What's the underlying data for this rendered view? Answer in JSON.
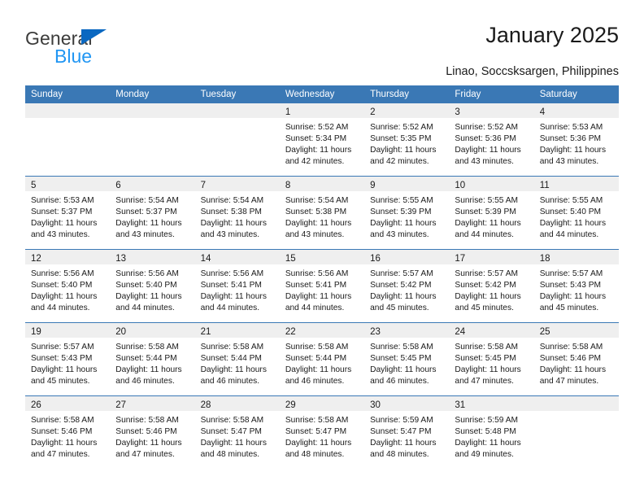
{
  "brand": {
    "name_top": "General",
    "name_bottom": "Blue",
    "accent_color": "#2196f3",
    "triangle_color": "#0a68c1",
    "top_text_color": "#3c3c3b"
  },
  "header": {
    "title": "January 2025",
    "subtitle": "Linao, Soccsksargen, Philippines"
  },
  "theme": {
    "header_bg": "#3a78b5",
    "header_text": "#ffffff",
    "daynum_band_bg": "#efefef",
    "row_divider": "#3a78b5",
    "cell_bg": "#ffffff",
    "text": "#1a1a1a"
  },
  "calendar": {
    "weekday_headers": [
      "Sunday",
      "Monday",
      "Tuesday",
      "Wednesday",
      "Thursday",
      "Friday",
      "Saturday"
    ],
    "weeks": [
      [
        {
          "day": "",
          "lines": []
        },
        {
          "day": "",
          "lines": []
        },
        {
          "day": "",
          "lines": []
        },
        {
          "day": "1",
          "lines": [
            "Sunrise: 5:52 AM",
            "Sunset: 5:34 PM",
            "Daylight: 11 hours",
            "and 42 minutes."
          ]
        },
        {
          "day": "2",
          "lines": [
            "Sunrise: 5:52 AM",
            "Sunset: 5:35 PM",
            "Daylight: 11 hours",
            "and 42 minutes."
          ]
        },
        {
          "day": "3",
          "lines": [
            "Sunrise: 5:52 AM",
            "Sunset: 5:36 PM",
            "Daylight: 11 hours",
            "and 43 minutes."
          ]
        },
        {
          "day": "4",
          "lines": [
            "Sunrise: 5:53 AM",
            "Sunset: 5:36 PM",
            "Daylight: 11 hours",
            "and 43 minutes."
          ]
        }
      ],
      [
        {
          "day": "5",
          "lines": [
            "Sunrise: 5:53 AM",
            "Sunset: 5:37 PM",
            "Daylight: 11 hours",
            "and 43 minutes."
          ]
        },
        {
          "day": "6",
          "lines": [
            "Sunrise: 5:54 AM",
            "Sunset: 5:37 PM",
            "Daylight: 11 hours",
            "and 43 minutes."
          ]
        },
        {
          "day": "7",
          "lines": [
            "Sunrise: 5:54 AM",
            "Sunset: 5:38 PM",
            "Daylight: 11 hours",
            "and 43 minutes."
          ]
        },
        {
          "day": "8",
          "lines": [
            "Sunrise: 5:54 AM",
            "Sunset: 5:38 PM",
            "Daylight: 11 hours",
            "and 43 minutes."
          ]
        },
        {
          "day": "9",
          "lines": [
            "Sunrise: 5:55 AM",
            "Sunset: 5:39 PM",
            "Daylight: 11 hours",
            "and 43 minutes."
          ]
        },
        {
          "day": "10",
          "lines": [
            "Sunrise: 5:55 AM",
            "Sunset: 5:39 PM",
            "Daylight: 11 hours",
            "and 44 minutes."
          ]
        },
        {
          "day": "11",
          "lines": [
            "Sunrise: 5:55 AM",
            "Sunset: 5:40 PM",
            "Daylight: 11 hours",
            "and 44 minutes."
          ]
        }
      ],
      [
        {
          "day": "12",
          "lines": [
            "Sunrise: 5:56 AM",
            "Sunset: 5:40 PM",
            "Daylight: 11 hours",
            "and 44 minutes."
          ]
        },
        {
          "day": "13",
          "lines": [
            "Sunrise: 5:56 AM",
            "Sunset: 5:40 PM",
            "Daylight: 11 hours",
            "and 44 minutes."
          ]
        },
        {
          "day": "14",
          "lines": [
            "Sunrise: 5:56 AM",
            "Sunset: 5:41 PM",
            "Daylight: 11 hours",
            "and 44 minutes."
          ]
        },
        {
          "day": "15",
          "lines": [
            "Sunrise: 5:56 AM",
            "Sunset: 5:41 PM",
            "Daylight: 11 hours",
            "and 44 minutes."
          ]
        },
        {
          "day": "16",
          "lines": [
            "Sunrise: 5:57 AM",
            "Sunset: 5:42 PM",
            "Daylight: 11 hours",
            "and 45 minutes."
          ]
        },
        {
          "day": "17",
          "lines": [
            "Sunrise: 5:57 AM",
            "Sunset: 5:42 PM",
            "Daylight: 11 hours",
            "and 45 minutes."
          ]
        },
        {
          "day": "18",
          "lines": [
            "Sunrise: 5:57 AM",
            "Sunset: 5:43 PM",
            "Daylight: 11 hours",
            "and 45 minutes."
          ]
        }
      ],
      [
        {
          "day": "19",
          "lines": [
            "Sunrise: 5:57 AM",
            "Sunset: 5:43 PM",
            "Daylight: 11 hours",
            "and 45 minutes."
          ]
        },
        {
          "day": "20",
          "lines": [
            "Sunrise: 5:58 AM",
            "Sunset: 5:44 PM",
            "Daylight: 11 hours",
            "and 46 minutes."
          ]
        },
        {
          "day": "21",
          "lines": [
            "Sunrise: 5:58 AM",
            "Sunset: 5:44 PM",
            "Daylight: 11 hours",
            "and 46 minutes."
          ]
        },
        {
          "day": "22",
          "lines": [
            "Sunrise: 5:58 AM",
            "Sunset: 5:44 PM",
            "Daylight: 11 hours",
            "and 46 minutes."
          ]
        },
        {
          "day": "23",
          "lines": [
            "Sunrise: 5:58 AM",
            "Sunset: 5:45 PM",
            "Daylight: 11 hours",
            "and 46 minutes."
          ]
        },
        {
          "day": "24",
          "lines": [
            "Sunrise: 5:58 AM",
            "Sunset: 5:45 PM",
            "Daylight: 11 hours",
            "and 47 minutes."
          ]
        },
        {
          "day": "25",
          "lines": [
            "Sunrise: 5:58 AM",
            "Sunset: 5:46 PM",
            "Daylight: 11 hours",
            "and 47 minutes."
          ]
        }
      ],
      [
        {
          "day": "26",
          "lines": [
            "Sunrise: 5:58 AM",
            "Sunset: 5:46 PM",
            "Daylight: 11 hours",
            "and 47 minutes."
          ]
        },
        {
          "day": "27",
          "lines": [
            "Sunrise: 5:58 AM",
            "Sunset: 5:46 PM",
            "Daylight: 11 hours",
            "and 47 minutes."
          ]
        },
        {
          "day": "28",
          "lines": [
            "Sunrise: 5:58 AM",
            "Sunset: 5:47 PM",
            "Daylight: 11 hours",
            "and 48 minutes."
          ]
        },
        {
          "day": "29",
          "lines": [
            "Sunrise: 5:58 AM",
            "Sunset: 5:47 PM",
            "Daylight: 11 hours",
            "and 48 minutes."
          ]
        },
        {
          "day": "30",
          "lines": [
            "Sunrise: 5:59 AM",
            "Sunset: 5:47 PM",
            "Daylight: 11 hours",
            "and 48 minutes."
          ]
        },
        {
          "day": "31",
          "lines": [
            "Sunrise: 5:59 AM",
            "Sunset: 5:48 PM",
            "Daylight: 11 hours",
            "and 49 minutes."
          ]
        },
        {
          "day": "",
          "lines": []
        }
      ]
    ]
  }
}
